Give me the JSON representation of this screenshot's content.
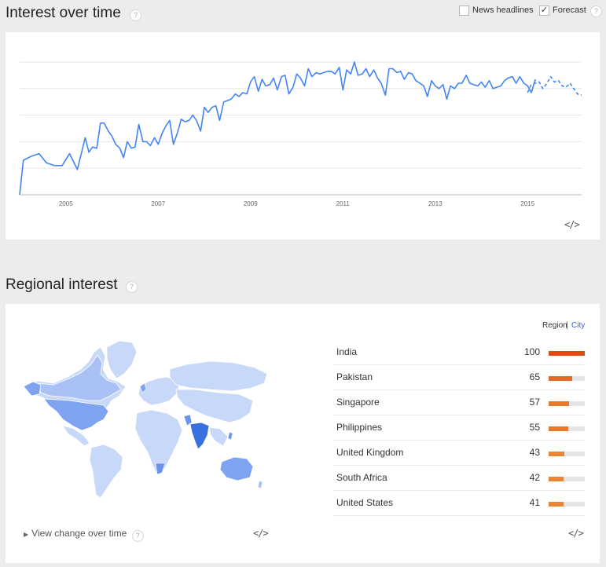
{
  "interest": {
    "title": "Interest over time",
    "help": "?",
    "news_headlines_label": "News headlines",
    "news_headlines_checked": false,
    "forecast_label": "Forecast",
    "forecast_checked": true,
    "embed": "</>",
    "chart_data": {
      "type": "line",
      "x_ticks": [
        "2005",
        "2007",
        "2009",
        "2011",
        "2013",
        "2015"
      ],
      "ylim": [
        0,
        100
      ],
      "grid": true,
      "series": [
        {
          "style": "solid",
          "color": "#4285f4",
          "points": [
            [
              2004.0,
              0
            ],
            [
              2004.08,
              26
            ],
            [
              2004.25,
              29
            ],
            [
              2004.42,
              31
            ],
            [
              2004.58,
              24
            ],
            [
              2004.75,
              22
            ],
            [
              2004.92,
              22
            ],
            [
              2005.08,
              31
            ],
            [
              2005.25,
              19
            ],
            [
              2005.42,
              43
            ],
            [
              2005.5,
              32
            ],
            [
              2005.58,
              36
            ],
            [
              2005.67,
              35
            ],
            [
              2005.75,
              54
            ],
            [
              2005.83,
              54
            ],
            [
              2005.92,
              48
            ],
            [
              2006.0,
              44
            ],
            [
              2006.08,
              38
            ],
            [
              2006.17,
              35
            ],
            [
              2006.25,
              28
            ],
            [
              2006.33,
              40
            ],
            [
              2006.42,
              35
            ],
            [
              2006.5,
              36
            ],
            [
              2006.58,
              53
            ],
            [
              2006.67,
              40
            ],
            [
              2006.75,
              40
            ],
            [
              2006.83,
              37
            ],
            [
              2006.92,
              43
            ],
            [
              2007.0,
              38
            ],
            [
              2007.08,
              46
            ],
            [
              2007.17,
              52
            ],
            [
              2007.25,
              56
            ],
            [
              2007.33,
              38
            ],
            [
              2007.42,
              47
            ],
            [
              2007.5,
              57
            ],
            [
              2007.58,
              55
            ],
            [
              2007.67,
              56
            ],
            [
              2007.75,
              60
            ],
            [
              2007.83,
              56
            ],
            [
              2007.92,
              48
            ],
            [
              2008.0,
              66
            ],
            [
              2008.08,
              62
            ],
            [
              2008.17,
              66
            ],
            [
              2008.25,
              67
            ],
            [
              2008.33,
              56
            ],
            [
              2008.42,
              70
            ],
            [
              2008.5,
              71
            ],
            [
              2008.58,
              72
            ],
            [
              2008.67,
              76
            ],
            [
              2008.75,
              74
            ],
            [
              2008.83,
              77
            ],
            [
              2008.92,
              76
            ],
            [
              2009.0,
              85
            ],
            [
              2009.08,
              89
            ],
            [
              2009.17,
              78
            ],
            [
              2009.25,
              87
            ],
            [
              2009.33,
              82
            ],
            [
              2009.42,
              83
            ],
            [
              2009.5,
              88
            ],
            [
              2009.58,
              79
            ],
            [
              2009.67,
              89
            ],
            [
              2009.75,
              90
            ],
            [
              2009.83,
              76
            ],
            [
              2009.92,
              81
            ],
            [
              2010.0,
              91
            ],
            [
              2010.08,
              88
            ],
            [
              2010.17,
              82
            ],
            [
              2010.25,
              95
            ],
            [
              2010.33,
              89
            ],
            [
              2010.42,
              92
            ],
            [
              2010.5,
              91
            ],
            [
              2010.58,
              92
            ],
            [
              2010.67,
              93
            ],
            [
              2010.75,
              93
            ],
            [
              2010.83,
              91
            ],
            [
              2010.92,
              96
            ],
            [
              2011.0,
              79
            ],
            [
              2011.08,
              94
            ],
            [
              2011.17,
              91
            ],
            [
              2011.25,
              100
            ],
            [
              2011.33,
              90
            ],
            [
              2011.42,
              91
            ],
            [
              2011.5,
              95
            ],
            [
              2011.58,
              89
            ],
            [
              2011.67,
              94
            ],
            [
              2011.75,
              88
            ],
            [
              2011.83,
              84
            ],
            [
              2011.92,
              75
            ],
            [
              2012.0,
              95
            ],
            [
              2012.08,
              95
            ],
            [
              2012.17,
              92
            ],
            [
              2012.25,
              93
            ],
            [
              2012.33,
              87
            ],
            [
              2012.42,
              92
            ],
            [
              2012.5,
              91
            ],
            [
              2012.58,
              86
            ],
            [
              2012.67,
              84
            ],
            [
              2012.75,
              82
            ],
            [
              2012.83,
              74
            ],
            [
              2012.92,
              86
            ],
            [
              2013.0,
              82
            ],
            [
              2013.08,
              80
            ],
            [
              2013.17,
              83
            ],
            [
              2013.25,
              72
            ],
            [
              2013.33,
              82
            ],
            [
              2013.42,
              80
            ],
            [
              2013.5,
              84
            ],
            [
              2013.58,
              84
            ],
            [
              2013.67,
              90
            ],
            [
              2013.75,
              84
            ],
            [
              2013.83,
              83
            ],
            [
              2013.92,
              82
            ],
            [
              2014.0,
              85
            ],
            [
              2014.08,
              81
            ],
            [
              2014.17,
              86
            ],
            [
              2014.25,
              80
            ],
            [
              2014.33,
              81
            ],
            [
              2014.42,
              82
            ],
            [
              2014.5,
              86
            ],
            [
              2014.58,
              88
            ],
            [
              2014.67,
              89
            ],
            [
              2014.75,
              84
            ],
            [
              2014.83,
              89
            ],
            [
              2014.92,
              84
            ],
            [
              2015.0,
              82
            ],
            [
              2015.08,
              77
            ],
            [
              2015.17,
              87
            ]
          ]
        },
        {
          "style": "dashed",
          "color": "#4285f4",
          "points": [
            [
              2015.0,
              77
            ],
            [
              2015.08,
              83
            ],
            [
              2015.17,
              84
            ],
            [
              2015.25,
              85
            ],
            [
              2015.33,
              80
            ],
            [
              2015.42,
              84
            ],
            [
              2015.5,
              89
            ],
            [
              2015.58,
              85
            ],
            [
              2015.67,
              86
            ],
            [
              2015.75,
              82
            ],
            [
              2015.83,
              81
            ],
            [
              2015.92,
              84
            ],
            [
              2016.0,
              80
            ],
            [
              2016.08,
              76
            ],
            [
              2016.17,
              75
            ]
          ]
        }
      ]
    }
  },
  "regional": {
    "title": "Regional interest",
    "help": "?",
    "toggle": {
      "region": "Region",
      "separator": "|",
      "city": "City"
    },
    "rows": [
      {
        "name": "India",
        "value": 100,
        "color": "#dc4d13"
      },
      {
        "name": "Pakistan",
        "value": 65,
        "color": "#e26a26"
      },
      {
        "name": "Singapore",
        "value": 57,
        "color": "#e97a2c"
      },
      {
        "name": "Philippines",
        "value": 55,
        "color": "#e97a2c"
      },
      {
        "name": "United Kingdom",
        "value": 43,
        "color": "#ea8432"
      },
      {
        "name": "South Africa",
        "value": 42,
        "color": "#ea8432"
      },
      {
        "name": "United States",
        "value": 41,
        "color": "#ea8432"
      }
    ],
    "view_change_label": "View change over time",
    "view_change_help": "?",
    "embed_map": "</>",
    "embed_list": "</>"
  }
}
